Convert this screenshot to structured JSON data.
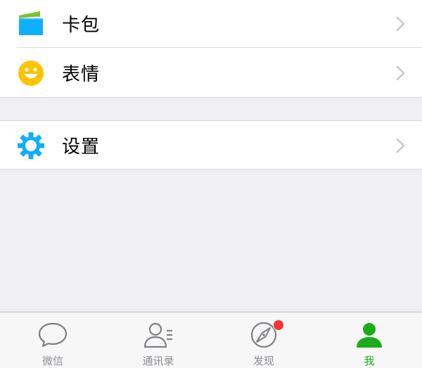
{
  "menu": {
    "items": [
      {
        "label": "卡包",
        "icon": "wallet-icon"
      },
      {
        "label": "表情",
        "icon": "smiley-icon"
      }
    ],
    "settings": {
      "label": "设置",
      "icon": "gear-icon"
    }
  },
  "tabbar": {
    "tabs": [
      {
        "label": "微信",
        "icon": "chat-bubble-icon",
        "active": false
      },
      {
        "label": "通讯录",
        "icon": "contacts-icon",
        "active": false
      },
      {
        "label": "发现",
        "icon": "compass-icon",
        "active": false,
        "badge": "dot"
      },
      {
        "label": "我",
        "icon": "person-icon",
        "active": true
      }
    ]
  },
  "colors": {
    "accent_green": "#1aad19",
    "icon_blue": "#10aeff",
    "icon_yellow": "#ffc300",
    "badge_red": "#f43530",
    "background": "#efeff4"
  }
}
